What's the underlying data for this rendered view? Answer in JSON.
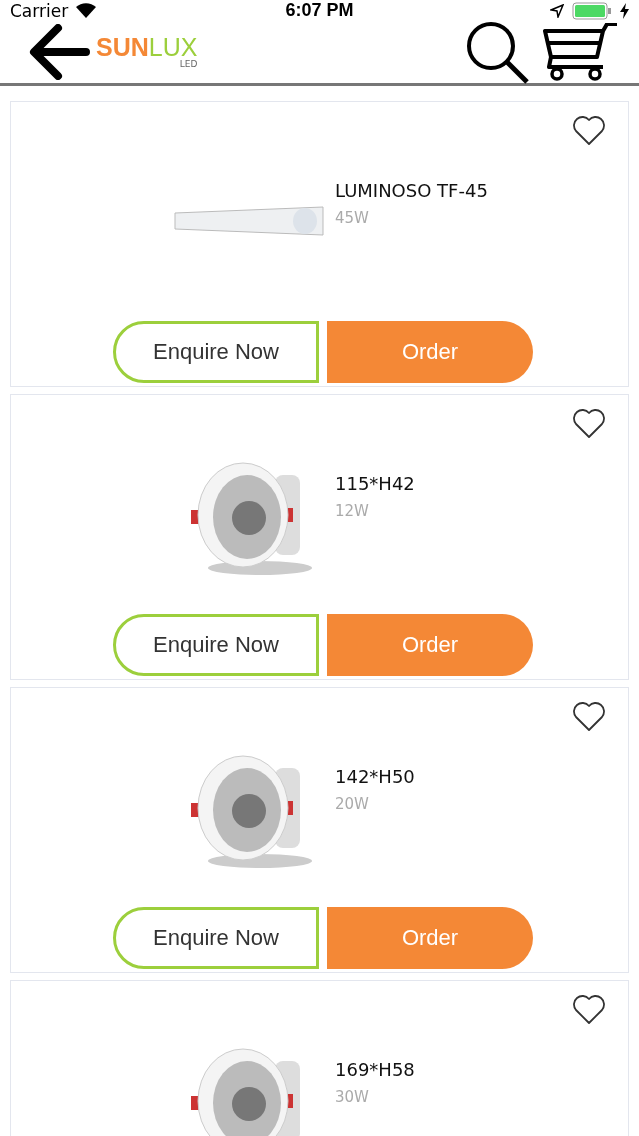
{
  "status_bar": {
    "carrier": "Carrier",
    "time": "6:07 PM"
  },
  "header": {
    "logo": {
      "part_1": "SUN",
      "part_2": "LUX",
      "subtitle": "LED"
    }
  },
  "products": [
    {
      "kind": "tube",
      "name": "LUMINOSO TF-45",
      "power": "45W",
      "favorite": false,
      "enquire_label": "Enquire Now",
      "order_label": "Order"
    },
    {
      "kind": "downlight",
      "name": "115*H42",
      "power": "12W",
      "favorite": false,
      "enquire_label": "Enquire Now",
      "order_label": "Order"
    },
    {
      "kind": "downlight",
      "name": "142*H50",
      "power": "20W",
      "favorite": false,
      "enquire_label": "Enquire Now",
      "order_label": "Order"
    },
    {
      "kind": "downlight",
      "name": "169*H58",
      "power": "30W",
      "favorite": false
    }
  ]
}
